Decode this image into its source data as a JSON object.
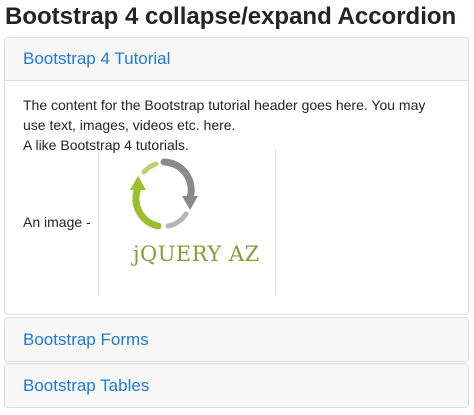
{
  "page": {
    "title": "Bootstrap 4 collapse/expand Accordion"
  },
  "accordion": {
    "panels": [
      {
        "label": "Bootstrap 4 Tutorial",
        "expanded": true,
        "body": {
          "line1": "The content for the Bootstrap tutorial header goes here. You may use text, images, videos etc. here.",
          "line2": "A like Bootstrap 4 tutorials.",
          "image_label": "An image -",
          "image_logo_text": "jQUERY AZ"
        }
      },
      {
        "label": "Bootstrap Forms",
        "expanded": false
      },
      {
        "label": "Bootstrap Tables",
        "expanded": false
      }
    ]
  },
  "colors": {
    "link": "#1f7ad8",
    "header_bg": "#f7f7f7",
    "logo_green": "#9bbf2f",
    "logo_gray": "#8a8a8a"
  }
}
